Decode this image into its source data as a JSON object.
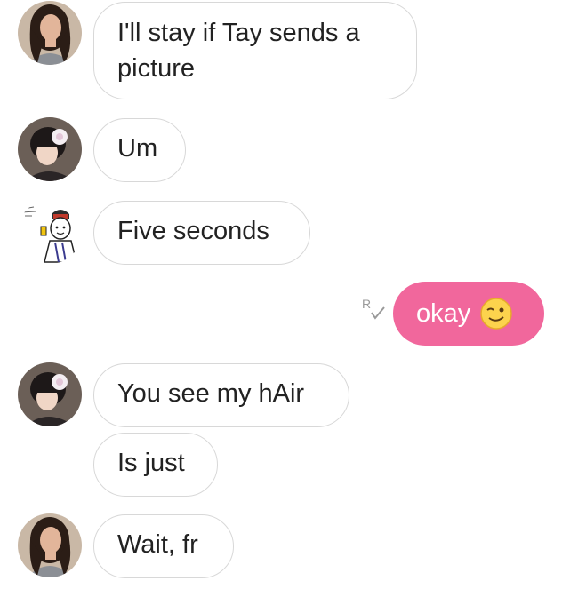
{
  "conversation": {
    "messages": [
      {
        "sender": "lea-avatar",
        "text": "I'll stay if Tay sends a picture"
      },
      {
        "sender": "yoongi-avatar",
        "text": "Um"
      },
      {
        "sender": "cartoon-avatar",
        "text": "Five seconds"
      },
      {
        "sender": "me",
        "text": "okay",
        "emoji": "winking-face-emoji",
        "receipt": "read-receipt-icon"
      },
      {
        "sender": "yoongi-avatar",
        "text": "You see my hAir"
      },
      {
        "sender": "yoongi-avatar",
        "text": "Is just"
      },
      {
        "sender": "lea-avatar",
        "text": "Wait, fr"
      }
    ]
  },
  "colors": {
    "outgoing_bubble": "#f1679c",
    "incoming_border": "#d8d8d8",
    "text": "#222222",
    "background": "#ffffff"
  }
}
